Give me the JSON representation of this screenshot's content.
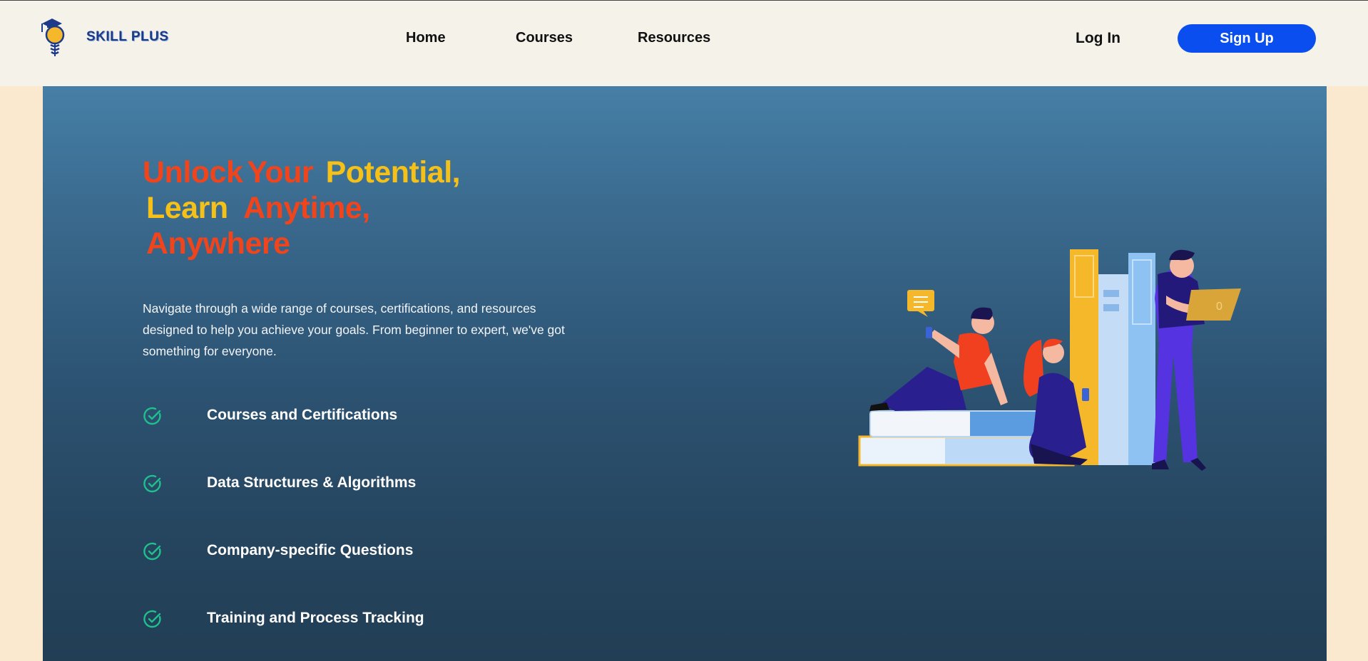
{
  "brand": {
    "name": "SKILL PLUS",
    "logo_icon": "graduation-lightbulb-icon"
  },
  "nav": {
    "links": [
      "Home",
      "Courses",
      "Resources"
    ],
    "login_label": "Log In",
    "signup_label": "Sign Up"
  },
  "hero": {
    "headline": {
      "line1": [
        "Unlock",
        "Your",
        "Potential,"
      ],
      "line2": [
        "Learn",
        "Anytime,"
      ],
      "line3": [
        "Anywhere"
      ]
    },
    "description": "Navigate through a wide range of courses, certifications, and resources designed to help you achieve your goals. From beginner to expert, we've got something for everyone.",
    "features": [
      "Courses and Certifications",
      "Data Structures & Algorithms",
      "Company-specific Questions",
      "Training and Process Tracking"
    ],
    "feature_icon": "check-circle-icon",
    "illustration": "students-with-books-illustration",
    "laptop_label": "0"
  },
  "colors": {
    "accent_blue": "#0a4ef0",
    "headline_red": "#f0441c",
    "headline_yellow": "#f5c018",
    "check_green": "#1fbf8f",
    "hero_top": "#467fa6",
    "hero_bottom": "#213e55",
    "nav_bg": "#f5f2ea",
    "page_bg": "#fbe9cf"
  }
}
